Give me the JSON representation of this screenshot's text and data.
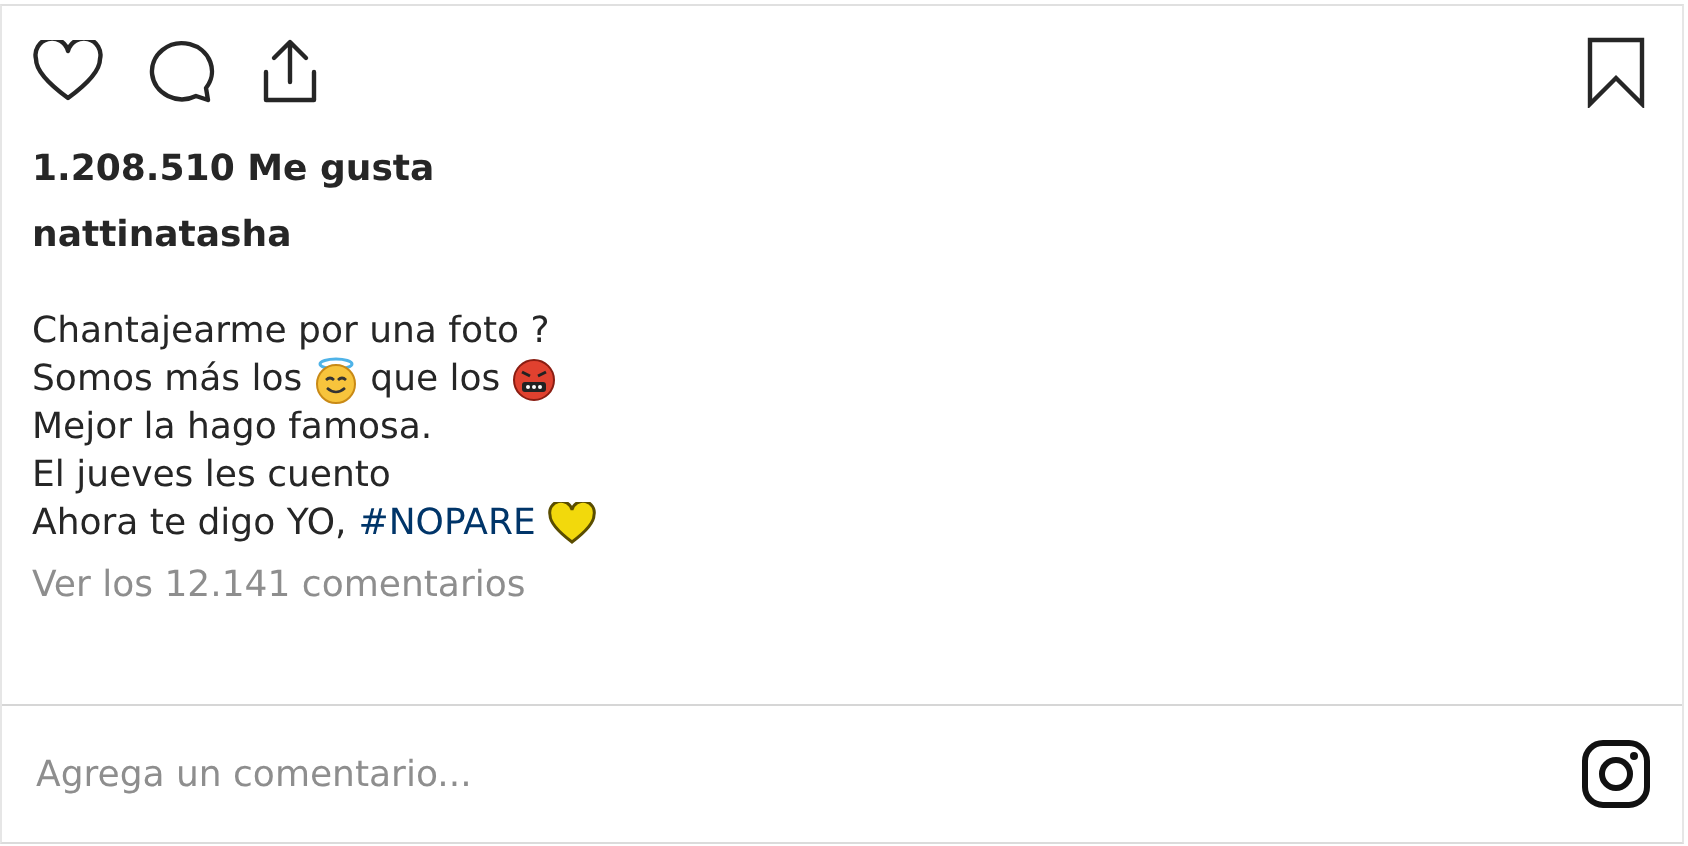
{
  "likes": "1.208.510 Me gusta",
  "username": "nattinatasha",
  "caption": [
    {
      "parts": [
        {
          "kind": "text",
          "text": "Chantajearme por una foto ?"
        }
      ]
    },
    {
      "parts": [
        {
          "kind": "text",
          "text": "Somos más los"
        },
        {
          "kind": "angel"
        },
        {
          "kind": "text",
          "text": "que los"
        },
        {
          "kind": "cursing"
        }
      ]
    },
    {
      "parts": [
        {
          "kind": "text",
          "text": "Mejor la hago famosa."
        }
      ]
    },
    {
      "parts": [
        {
          "kind": "text",
          "text": "El jueves les cuento"
        }
      ]
    },
    {
      "parts": [
        {
          "kind": "text",
          "text": "Ahora te digo YO,"
        },
        {
          "kind": "hashtag",
          "text": "#NOPARE"
        },
        {
          "kind": "heart"
        }
      ]
    }
  ],
  "comments_link": "Ver los 12.141 comentarios",
  "comment_field": {
    "placeholder": "Agrega un comentario..."
  }
}
